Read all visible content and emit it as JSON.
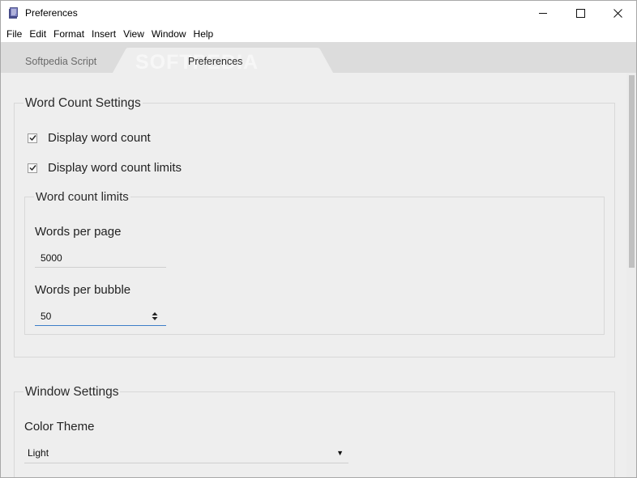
{
  "window": {
    "title": "Preferences",
    "controls": {
      "minimize": "minimize",
      "maximize": "maximize",
      "close": "close"
    }
  },
  "menubar": {
    "items": [
      {
        "label": "File"
      },
      {
        "label": "Edit"
      },
      {
        "label": "Format"
      },
      {
        "label": "Insert"
      },
      {
        "label": "View"
      },
      {
        "label": "Window"
      },
      {
        "label": "Help"
      }
    ]
  },
  "tabs": {
    "inactive": {
      "label": "Softpedia Script"
    },
    "active": {
      "label": "Preferences"
    },
    "watermark": "SOFTPEDIA"
  },
  "word_count_settings": {
    "title": "Word Count Settings",
    "display_word_count": {
      "label": "Display word count",
      "checked": true
    },
    "display_word_count_limits": {
      "label": "Display word count limits",
      "checked": true
    },
    "limits": {
      "title": "Word count limits",
      "words_per_page": {
        "label": "Words per page",
        "value": "5000"
      },
      "words_per_bubble": {
        "label": "Words per bubble",
        "value": "50"
      }
    }
  },
  "window_settings": {
    "title": "Window Settings",
    "color_theme": {
      "label": "Color Theme",
      "value": "Light"
    }
  },
  "colors": {
    "content_bg": "#eeeeee",
    "tabstrip_bg": "#dcdcdc",
    "focus_accent": "#3d7ec8"
  }
}
